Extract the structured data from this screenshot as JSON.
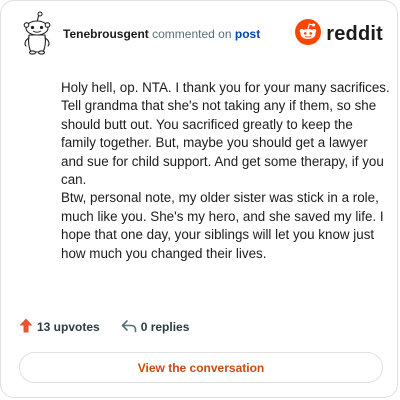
{
  "comment": {
    "username": "Tenebrousgent",
    "action_text": "commented on",
    "post_link": "post",
    "paragraphs": [
      "Holy hell, op. NTA. I thank you for your many sacrifices. Tell grandma that she's not taking any if them, so she should butt out. You sacrificed greatly to keep the family together. But, maybe you should get a lawyer and sue for child support. And get some therapy, if you can.",
      "Btw, personal note, my older sister was stick in a role, much like you. She's my hero, and she saved my life. I hope that one day, your siblings will let you know just how much you changed their lives."
    ]
  },
  "brand": {
    "name": "reddit",
    "logo_icon": "reddit-snoo-icon",
    "color": "#ff4500"
  },
  "stats": {
    "upvotes": "13 upvotes",
    "upvote_icon": "upvote-arrow-icon",
    "upvote_color": "#e8542f",
    "replies": "0 replies",
    "reply_icon": "reply-arrow-icon"
  },
  "cta": {
    "label": "View the conversation",
    "color": "#cc4a12"
  },
  "avatar": {
    "icon": "snoo-avatar-icon"
  }
}
